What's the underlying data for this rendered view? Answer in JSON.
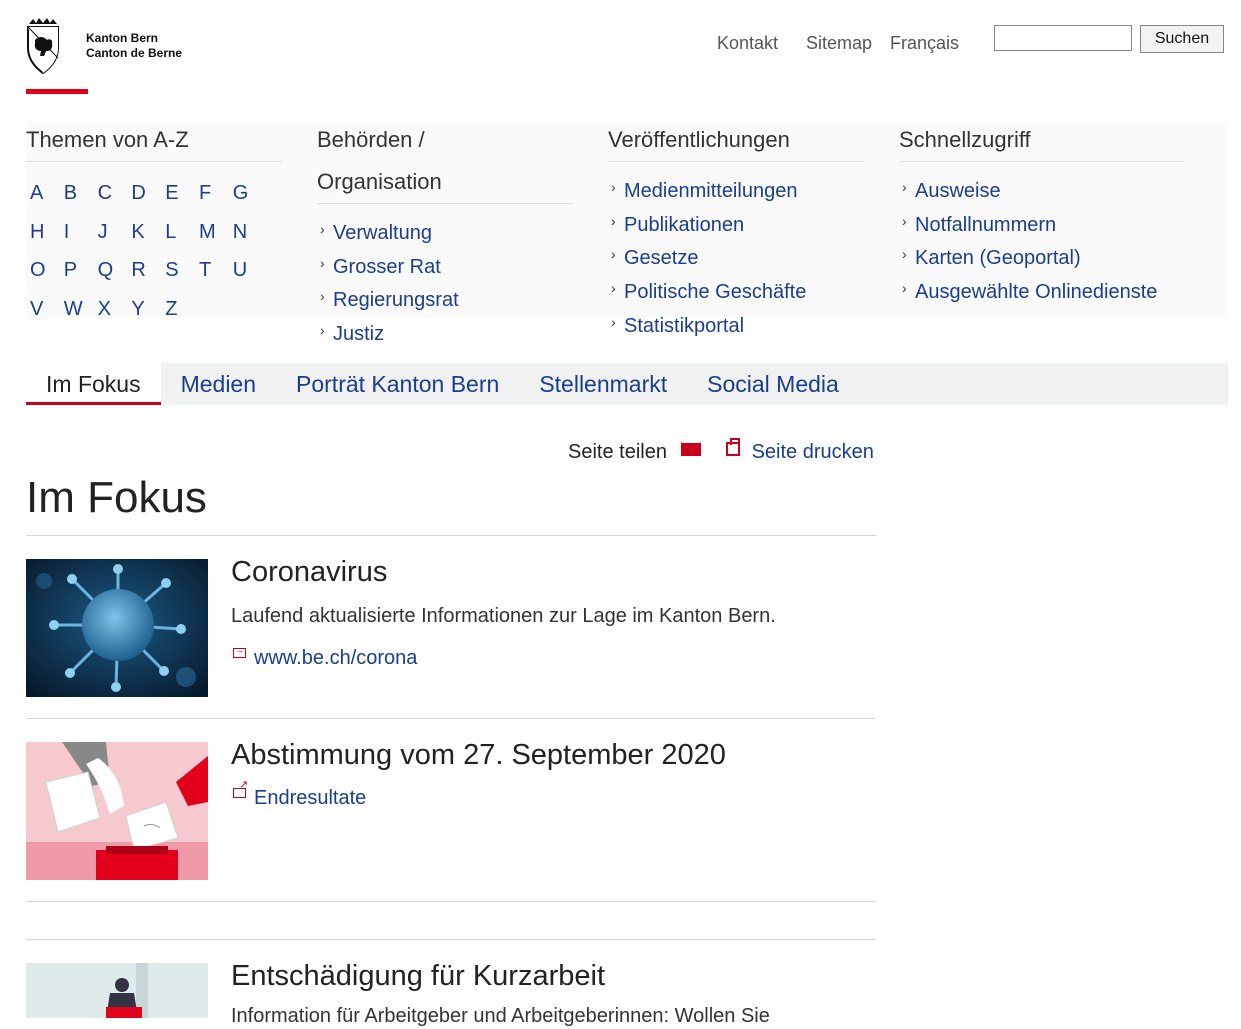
{
  "brand": {
    "line1": "Kanton Bern",
    "line2": "Canton de Berne"
  },
  "topnav": {
    "contact": "Kontakt",
    "sitemap": "Sitemap",
    "language": "Français"
  },
  "search": {
    "value": "",
    "button": "Suchen"
  },
  "menu": {
    "az": {
      "title": "Themen von A-Z",
      "letters": [
        "A",
        "B",
        "C",
        "D",
        "E",
        "F",
        "G",
        "H",
        "I",
        "J",
        "K",
        "L",
        "M",
        "N",
        "O",
        "P",
        "Q",
        "R",
        "S",
        "T",
        "U",
        "V",
        "W",
        "X",
        "Y",
        "Z"
      ]
    },
    "authorities": {
      "title_line1": "Behörden /",
      "title_line2": "Organisation",
      "items": [
        "Verwaltung",
        "Grosser Rat",
        "Regierungsrat",
        "Justiz"
      ]
    },
    "publications": {
      "title": "Veröffentlichungen",
      "items": [
        "Medienmitteilungen",
        "Publikationen",
        "Gesetze",
        "Politische Geschäfte",
        "Statistikportal"
      ]
    },
    "quick": {
      "title": "Schnellzugriff",
      "items": [
        "Ausweise",
        "Notfallnummern",
        "Karten (Geoportal)",
        "Ausgewählte Onlinedienste"
      ]
    }
  },
  "tabs": [
    "Im Fokus",
    "Medien",
    "Porträt Kanton Bern",
    "Stellenmarkt",
    "Social Media"
  ],
  "tools": {
    "share": "Seite teilen",
    "print": "Seite drucken"
  },
  "page_title": "Im Fokus",
  "items": [
    {
      "title": "Coronavirus",
      "text": "Laufend aktualisierte Informationen zur Lage im Kanton Bern.",
      "link": "www.be.ch/corona"
    },
    {
      "title": "Abstimmung vom 27. September 2020",
      "link": "Endresultate"
    },
    {
      "title": "Entschädigung für Kurzarbeit",
      "text": "Information für Arbeitgeber und Arbeitgeberinnen: Wollen Sie"
    }
  ],
  "colors": {
    "accent_red": "#e2001a",
    "link_blue": "#1a3d8f",
    "tab_bg": "#f0f1f1"
  }
}
